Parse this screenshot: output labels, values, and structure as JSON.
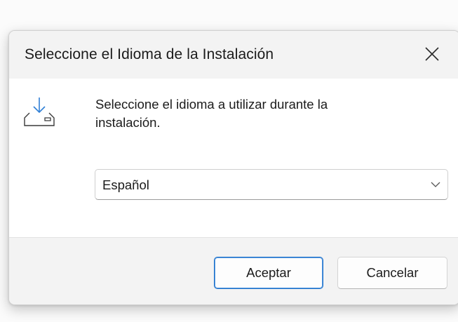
{
  "window": {
    "title": "Seleccione el Idioma de la Instalación",
    "close_icon": "close-icon"
  },
  "content": {
    "icon": "install-download-icon",
    "message_line1": "Seleccione el idioma a utilizar durante la",
    "message_line2": "instalación.",
    "language_select": {
      "selected": "Español",
      "chevron_icon": "chevron-down-icon"
    }
  },
  "footer": {
    "accept_label": "Aceptar",
    "cancel_label": "Cancelar"
  },
  "colors": {
    "accent": "#1a6fc9",
    "icon_blue": "#2f7fd6",
    "titlebar": "#f3f3f3"
  }
}
